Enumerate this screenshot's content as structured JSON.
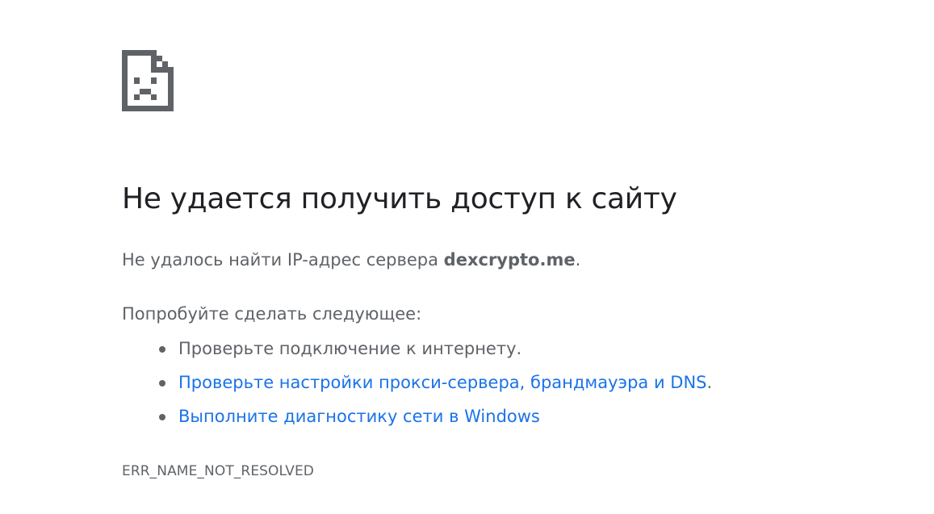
{
  "icon": "sad-page-icon",
  "title": "Не удается получить доступ к сайту",
  "summary": {
    "prefix": "Не удалось найти IP-адрес сервера ",
    "host": "dexcrypto.me",
    "suffix": "."
  },
  "suggestions_heading": "Попробуйте сделать следующее:",
  "suggestions": [
    {
      "text": "Проверьте подключение к интернету.",
      "link": false,
      "trail": ""
    },
    {
      "text": "Проверьте настройки прокси-сервера, брандмауэра и DNS",
      "link": true,
      "trail": "."
    },
    {
      "text": "Выполните диагностику сети в Windows",
      "link": true,
      "trail": ""
    }
  ],
  "error_code": "ERR_NAME_NOT_RESOLVED",
  "colors": {
    "heading": "#202124",
    "text": "#5f6368",
    "link": "#1a73e8",
    "icon": "#5f6368"
  }
}
